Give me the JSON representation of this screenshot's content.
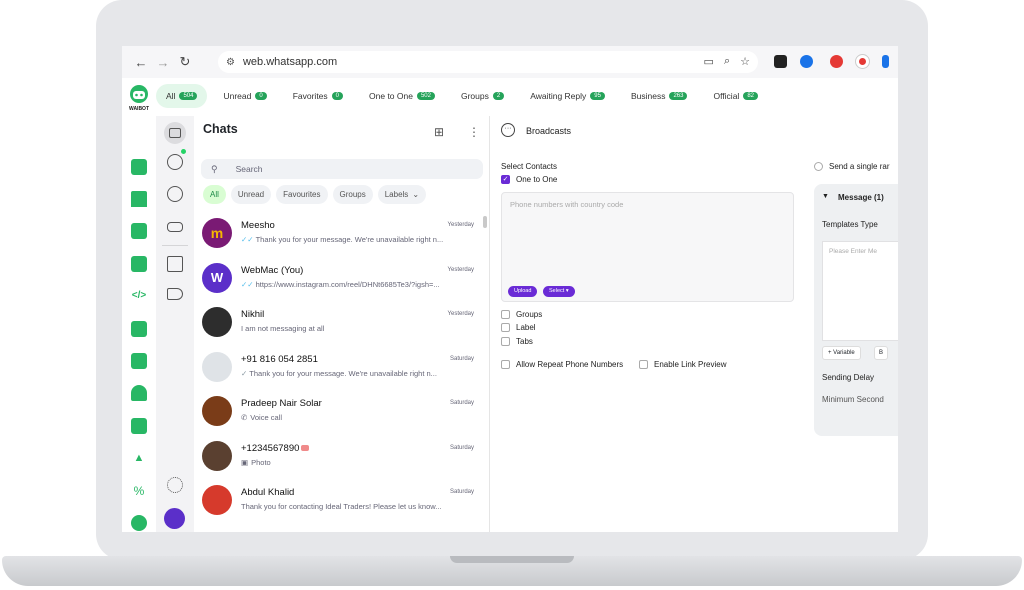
{
  "browser": {
    "url": "web.whatsapp.com"
  },
  "brand": {
    "logo_text": "WAIBOT"
  },
  "filter_tabs": [
    {
      "label": "All",
      "count": "504",
      "active": true
    },
    {
      "label": "Unread",
      "count": "0"
    },
    {
      "label": "Favorites",
      "count": "0"
    },
    {
      "label": "One to One",
      "count": "502"
    },
    {
      "label": "Groups",
      "count": "2"
    },
    {
      "label": "Awaiting Reply",
      "count": "95"
    },
    {
      "label": "Business",
      "count": "263"
    },
    {
      "label": "Official",
      "count": "82"
    }
  ],
  "chats": {
    "title": "Chats",
    "search_placeholder": "Search",
    "chips": [
      "All",
      "Unread",
      "Favourites",
      "Groups",
      "Labels"
    ],
    "rows": [
      {
        "name": "Meesho",
        "time": "Yesterday",
        "msg": "Thank you for your message. We're unavailable right n...",
        "tick": true,
        "avatar_color": "#7a1a74"
      },
      {
        "name": "WebMac (You)",
        "time": "Yesterday",
        "msg": "https://www.instagram.com/reel/DHNt6685Te3/?igsh=...",
        "tick": true,
        "avatar_color": "#5b2fc9"
      },
      {
        "name": "Nikhil",
        "time": "Yesterday",
        "msg": "I am not messaging at all",
        "tick": false,
        "avatar_color": "#2d2d2d"
      },
      {
        "name": "+91 816 054 2851",
        "time": "Saturday",
        "msg": "Thank you for your message. We're unavailable right n...",
        "tick": true,
        "avatar_color": "#dfe3e7"
      },
      {
        "name": "Pradeep Nair Solar",
        "time": "Saturday",
        "msg": "Voice call",
        "tick": false,
        "avatar_color": "#7a3c18"
      },
      {
        "name": "+1234567890",
        "time": "Saturday",
        "msg": "Photo",
        "tick": false,
        "avatar_color": "#5a4030"
      },
      {
        "name": "Abdul Khalid",
        "time": "Saturday",
        "msg": "Thank you for contacting Ideal Traders! Please let us know...",
        "tick": false,
        "avatar_color": "#d63a2c"
      }
    ]
  },
  "broadcast": {
    "title": "Broadcasts",
    "select_contacts_label": "Select Contacts",
    "one_to_one_label": "One to One",
    "phone_placeholder": "Phone numbers with country code",
    "upload_label": "Upload",
    "select_label": "Select",
    "groups_label": "Groups",
    "label_label": "Label",
    "tabs_label": "Tabs",
    "allow_repeat_label": "Allow Repeat Phone Numbers",
    "enable_preview_label": "Enable Link Preview",
    "send_single_label": "Send a single rar",
    "message_header": "Message (1)",
    "templates_type_label": "Templates Type",
    "template_placeholder": "Please Enter Me",
    "variable_label": "+ Variable",
    "bold_label": "B",
    "sending_delay_label": "Sending Delay",
    "min_seconds_label": "Minimum Second"
  },
  "colors": {
    "accent_green": "#25a35a",
    "purple": "#6a2bd6"
  }
}
